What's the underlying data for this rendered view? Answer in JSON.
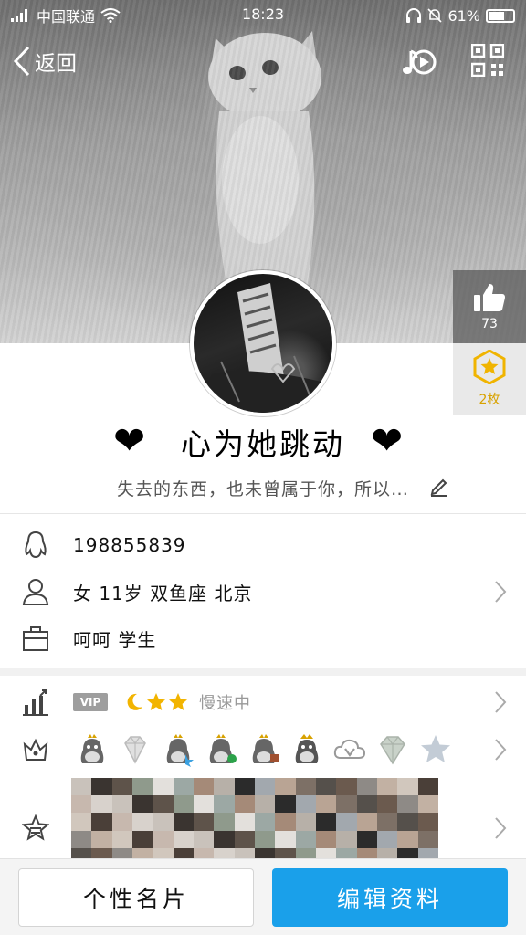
{
  "status_bar": {
    "carrier": "中国联通",
    "time": "18:23",
    "battery": "61%",
    "battery_level": 0.61
  },
  "nav": {
    "back_label": "返回"
  },
  "likes": {
    "count": "73"
  },
  "badge": {
    "label": "2枚"
  },
  "profile": {
    "nickname": "心为她跳动",
    "heart_left": "❤",
    "heart_right": "❤",
    "signature": "失去的东西，也未曾属于你，所以…"
  },
  "info": {
    "qq_number": "198855839",
    "basic": "女  11岁  双鱼座  北京",
    "occupation": "呵呵 学生"
  },
  "vip": {
    "tag": "VIP",
    "level_icons": [
      "moon",
      "star",
      "star"
    ],
    "status": "慢速中"
  },
  "emblems": [
    "penguin-crown-icon",
    "diamond-icon",
    "penguin-crown-icon",
    "penguin-crown-icon",
    "penguin-crown-icon",
    "penguin-crown-icon",
    "cloud-v-icon",
    "diamond-icon",
    "star-icon"
  ],
  "colors": {
    "accent": "#1aa0ea",
    "badge_gold": "#f0b400",
    "like_box": "#5a5a5a"
  },
  "buttons": {
    "card": "个性名片",
    "edit": "编辑资料"
  }
}
